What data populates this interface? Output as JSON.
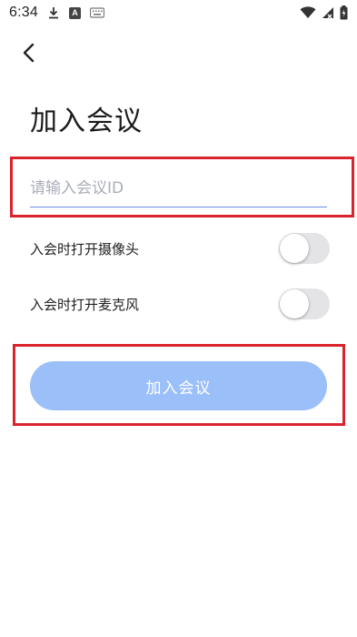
{
  "status_bar": {
    "time": "6:34",
    "left_icons": [
      "download-icon",
      "a-box-icon",
      "keyboard-icon"
    ],
    "right_icons": [
      "wifi-icon",
      "signal-icon",
      "battery-icon"
    ]
  },
  "header": {
    "back_icon": "chevron-left-icon",
    "title": "加入会议"
  },
  "form": {
    "meeting_id_placeholder": "请输入会议ID",
    "meeting_id_value": "",
    "camera_toggle_label": "入会时打开摄像头",
    "camera_on": false,
    "mic_toggle_label": "入会时打开麦克风",
    "mic_on": false,
    "join_button_label": "加入会议"
  },
  "colors": {
    "join_button_bg": "#9bbff8",
    "input_underline": "#6b8be8",
    "highlight_border": "#d9232d",
    "switch_off_track": "#e4e4e7"
  }
}
